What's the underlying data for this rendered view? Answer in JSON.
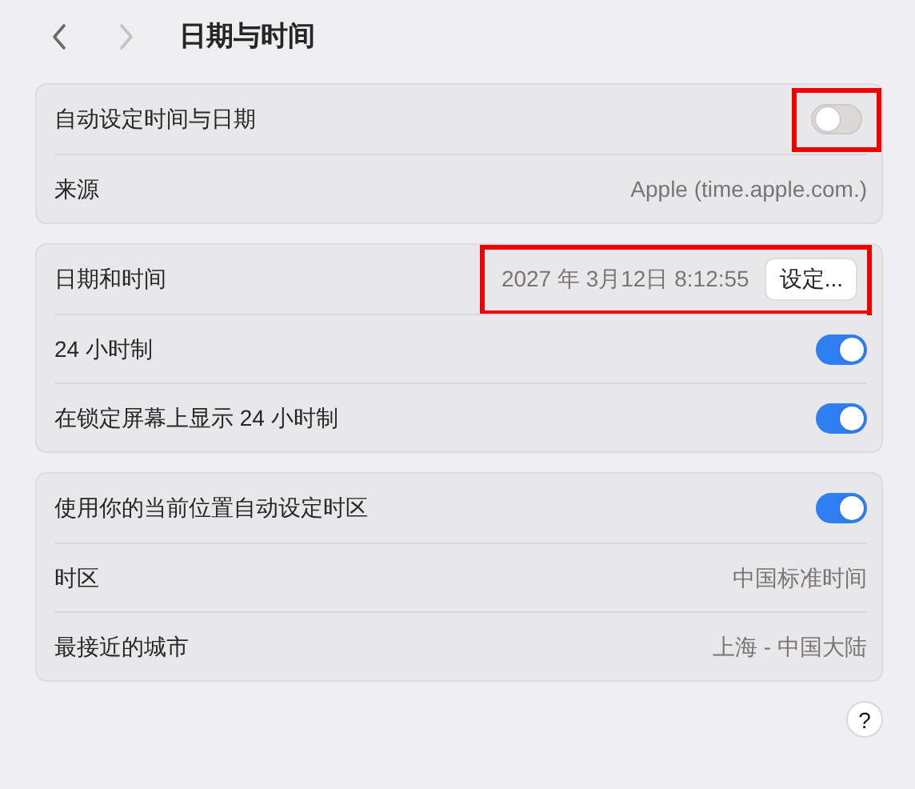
{
  "toolbar": {
    "nav": [
      {
        "kind": "back",
        "disabled": false
      },
      {
        "kind": "forward",
        "disabled": true
      }
    ],
    "title": "日期与时间"
  },
  "groups": [
    {
      "rows": [
        {
          "kind": "toggle",
          "label": "自动设定时间与日期",
          "on": false,
          "highlighted": true
        },
        {
          "kind": "value",
          "label": "来源",
          "value": "Apple (time.apple.com.)"
        }
      ]
    },
    {
      "rows": [
        {
          "kind": "datetime",
          "label": "日期和时间",
          "value": "2027 年 3月12日 8:12:55",
          "button": "设定...",
          "highlighted": true
        },
        {
          "kind": "toggle",
          "label": "24 小时制",
          "on": true
        },
        {
          "kind": "toggle",
          "label": "在锁定屏幕上显示 24 小时制",
          "on": true
        }
      ]
    },
    {
      "rows": [
        {
          "kind": "toggle",
          "label": "使用你的当前位置自动设定时区",
          "on": true
        },
        {
          "kind": "value",
          "label": "时区",
          "value": "中国标准时间"
        },
        {
          "kind": "value",
          "label": "最接近的城市",
          "value": "上海 - 中国大陆"
        }
      ]
    }
  ],
  "help_button": "?"
}
